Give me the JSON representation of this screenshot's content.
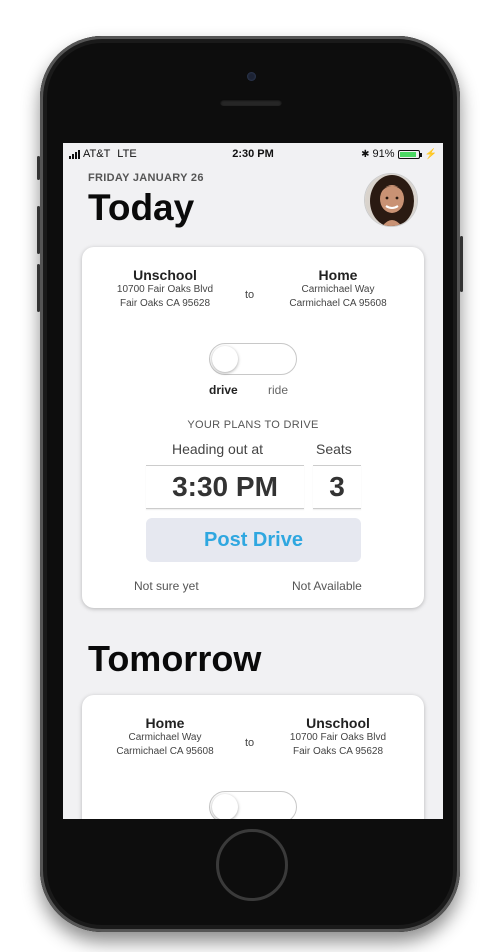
{
  "status_bar": {
    "carrier": "AT&T",
    "network": "LTE",
    "time": "2:30 PM",
    "battery_percent": "91%",
    "battery_level": 0.91
  },
  "header": {
    "date": "FRIDAY JANUARY 26",
    "title": "Today"
  },
  "today_card": {
    "from": {
      "name": "Unschool",
      "line1": "10700 Fair Oaks Blvd",
      "line2": "Fair Oaks CA 95628"
    },
    "to_word": "to",
    "to": {
      "name": "Home",
      "line1": "Carmichael Way",
      "line2": "Carmichael CA 95608"
    },
    "toggle": {
      "left_label": "drive",
      "right_label": "ride",
      "selected": "drive"
    },
    "plans_title": "YOUR PLANS TO DRIVE",
    "heading_label": "Heading out at",
    "seats_label": "Seats",
    "time_value": "3:30 PM",
    "seats_value": "3",
    "post_button": "Post Drive",
    "not_sure": "Not sure yet",
    "not_available": "Not Available"
  },
  "tomorrow_title": "Tomorrow",
  "tomorrow_card": {
    "from": {
      "name": "Home",
      "line1": "Carmichael Way",
      "line2": "Carmichael CA 95608"
    },
    "to_word": "to",
    "to": {
      "name": "Unschool",
      "line1": "10700 Fair Oaks Blvd",
      "line2": "Fair Oaks CA 95628"
    }
  },
  "colors": {
    "accent": "#2fa7e0",
    "button_bg": "#e6e8f0",
    "screen_bg": "#f1f1f3",
    "battery": "#4cd964"
  },
  "icons": [
    "signal-icon",
    "bluetooth-icon",
    "battery-icon",
    "charging-icon",
    "profile-avatar"
  ]
}
